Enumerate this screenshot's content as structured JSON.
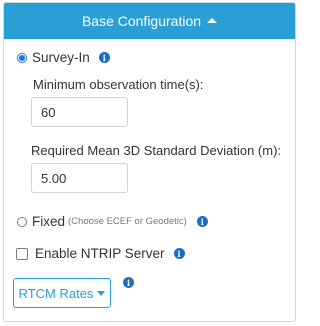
{
  "header": {
    "title": "Base Configuration",
    "caret_icon": "caret-up-icon"
  },
  "survey_in": {
    "label": "Survey-In",
    "selected": true,
    "min_obs_label": "Minimum observation time(s):",
    "min_obs_value": "60",
    "std_dev_label": "Required Mean 3D Standard Deviation (m):",
    "std_dev_value": "5.00"
  },
  "fixed": {
    "label": "Fixed",
    "hint": "(Choose ECEF or Geodetic)",
    "selected": false
  },
  "ntrip": {
    "label": "Enable NTRIP Server",
    "checked": false
  },
  "rtcm": {
    "label": "RTCM Rates"
  },
  "info_icon_glyph": "i",
  "colors": {
    "header_bg": "#2a9fd6",
    "accent": "#2a9fd6",
    "info": "#1c6ec2",
    "radio_checked": "#1a73e8"
  }
}
